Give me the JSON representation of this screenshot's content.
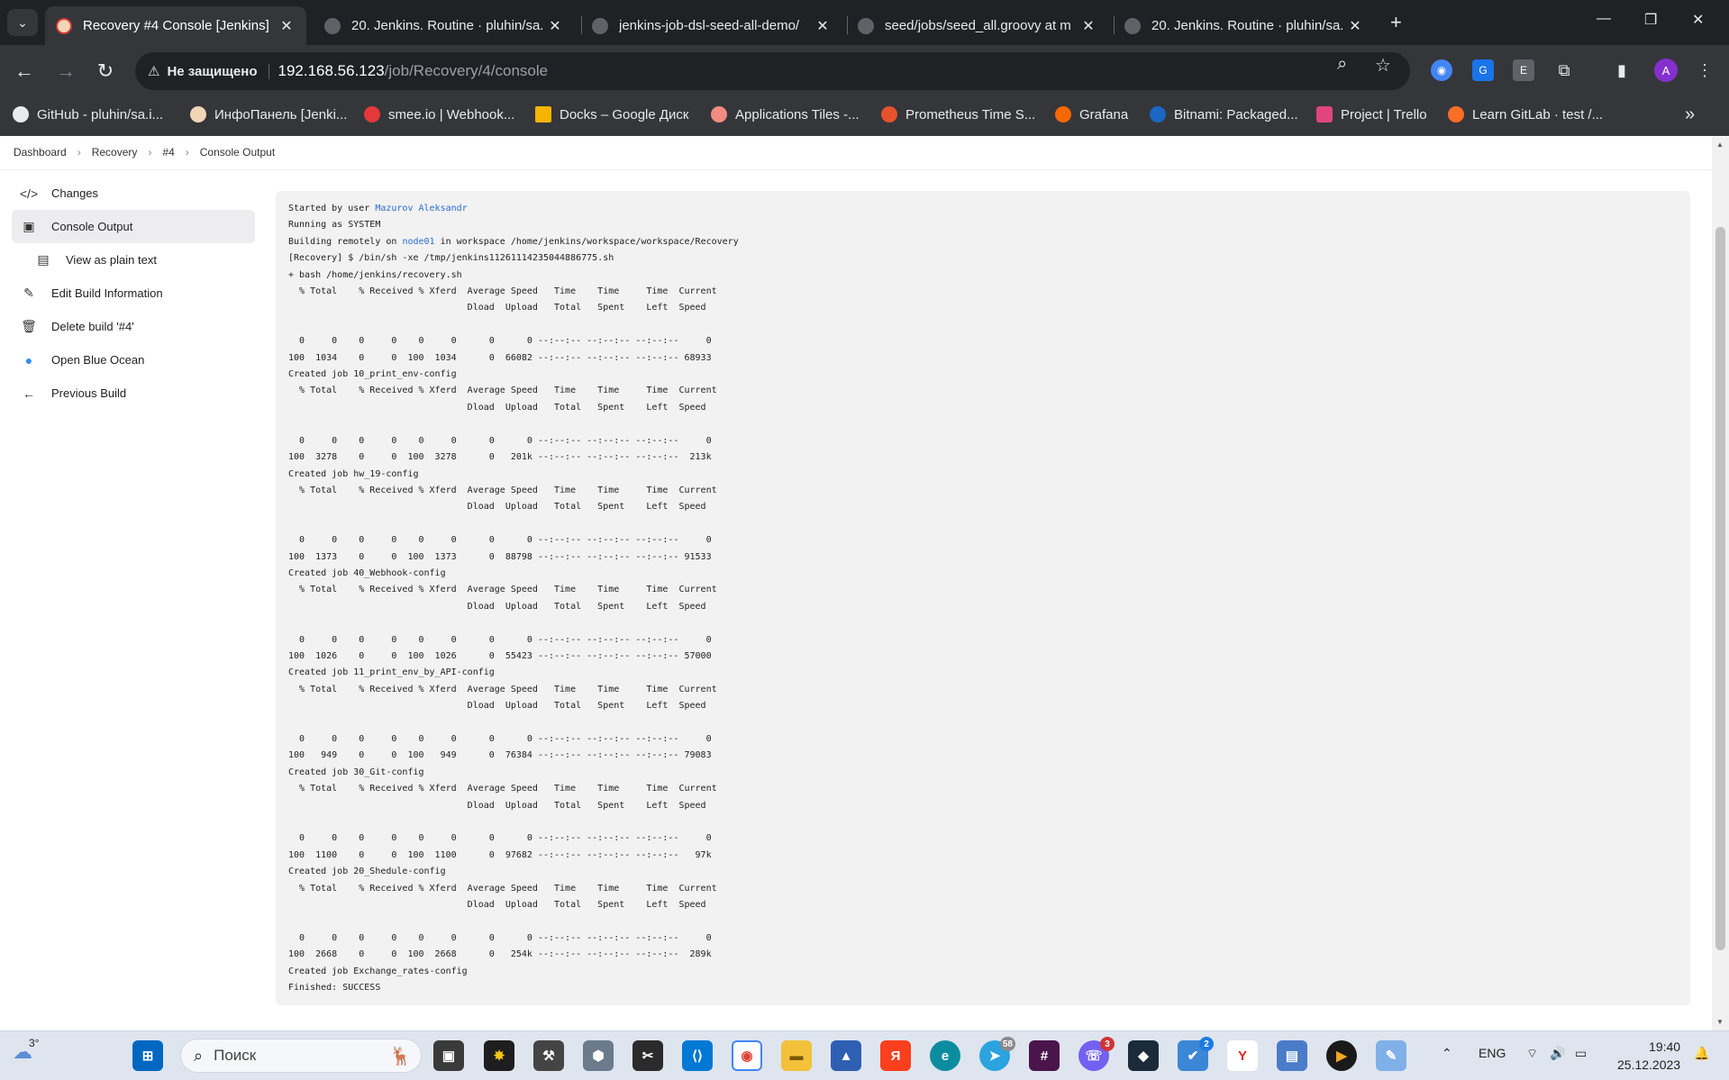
{
  "browser": {
    "tabs": [
      {
        "title": "Recovery #4 Console [Jenkins]",
        "active": true,
        "icon": "jenkins-icon"
      },
      {
        "title": "20. Jenkins. Routine · pluhin/sa.",
        "active": false,
        "icon": "github-icon"
      },
      {
        "title": "jenkins-job-dsl-seed-all-demo/",
        "active": false,
        "icon": "github-icon"
      },
      {
        "title": "seed/jobs/seed_all.groovy at m",
        "active": false,
        "icon": "github-icon"
      },
      {
        "title": "20. Jenkins. Routine · pluhin/sa.",
        "active": false,
        "icon": "github-icon"
      }
    ],
    "close_glyph": "✕",
    "new_tab_glyph": "+",
    "address": {
      "security_label": "Не защищено",
      "host": "192.168.56.123",
      "path": "/job/Recovery/4/console"
    },
    "profile_initial": "A",
    "bookmarks": [
      {
        "label": "GitHub - pluhin/sa.i...",
        "color": "#e8eaed"
      },
      {
        "label": "ИнфоПанель [Jenki...",
        "color": "#f0d6b7"
      },
      {
        "label": "smee.io | Webhook...",
        "color": "#e5383b"
      },
      {
        "label": "Docks – Google Диск",
        "color": "#f4b400"
      },
      {
        "label": "Applications Tiles -...",
        "color": "#f28b82"
      },
      {
        "label": "Prometheus Time S...",
        "color": "#e6522c"
      },
      {
        "label": "Grafana",
        "color": "#f46800"
      },
      {
        "label": "Bitnami: Packaged...",
        "color": "#1b67c3"
      },
      {
        "label": "Project | Trello",
        "color": "#e0457b"
      },
      {
        "label": "Learn GitLab · test /...",
        "color": "#fc6d26"
      }
    ]
  },
  "breadcrumb": [
    "Dashboard",
    "Recovery",
    "#4",
    "Console Output"
  ],
  "sidebar": {
    "items": [
      {
        "label": "Changes",
        "icon": "code-icon",
        "glyph": "</>"
      },
      {
        "label": "Console Output",
        "icon": "terminal-icon",
        "glyph": "▣"
      },
      {
        "label": "View as plain text",
        "icon": "document-icon",
        "glyph": "▤"
      },
      {
        "label": "Edit Build Information",
        "icon": "edit-icon",
        "glyph": "✎"
      },
      {
        "label": "Delete build '#4'",
        "icon": "trash-icon",
        "glyph": "🗑"
      },
      {
        "label": "Open Blue Ocean",
        "icon": "blue-ocean-icon",
        "glyph": "●"
      },
      {
        "label": "Previous Build",
        "icon": "arrow-left-icon",
        "glyph": "←"
      }
    ]
  },
  "console": {
    "started_prefix": "Started by user ",
    "user": "Mazurov Aleksandr",
    "running": "Running as SYSTEM",
    "building_prefix": "Building remotely on ",
    "node": "node01",
    "building_suffix": " in workspace /home/jenkins/workspace/workspace/Recovery",
    "lines": [
      "[Recovery] $ /bin/sh -xe /tmp/jenkins11261114235044886775.sh",
      "+ bash /home/jenkins/recovery.sh",
      "  % Total    % Received % Xferd  Average Speed   Time    Time     Time  Current",
      "                                 Dload  Upload   Total   Spent    Left  Speed",
      "",
      "  0     0    0     0    0     0      0      0 --:--:-- --:--:-- --:--:--     0",
      "100  1034    0     0  100  1034      0  66082 --:--:-- --:--:-- --:--:-- 68933",
      "Created job 10_print_env-config",
      "  % Total    % Received % Xferd  Average Speed   Time    Time     Time  Current",
      "                                 Dload  Upload   Total   Spent    Left  Speed",
      "",
      "  0     0    0     0    0     0      0      0 --:--:-- --:--:-- --:--:--     0",
      "100  3278    0     0  100  3278      0   201k --:--:-- --:--:-- --:--:--  213k",
      "Created job hw_19-config",
      "  % Total    % Received % Xferd  Average Speed   Time    Time     Time  Current",
      "                                 Dload  Upload   Total   Spent    Left  Speed",
      "",
      "  0     0    0     0    0     0      0      0 --:--:-- --:--:-- --:--:--     0",
      "100  1373    0     0  100  1373      0  88798 --:--:-- --:--:-- --:--:-- 91533",
      "Created job 40_Webhook-config",
      "  % Total    % Received % Xferd  Average Speed   Time    Time     Time  Current",
      "                                 Dload  Upload   Total   Spent    Left  Speed",
      "",
      "  0     0    0     0    0     0      0      0 --:--:-- --:--:-- --:--:--     0",
      "100  1026    0     0  100  1026      0  55423 --:--:-- --:--:-- --:--:-- 57000",
      "Created job 11_print_env_by_API-config",
      "  % Total    % Received % Xferd  Average Speed   Time    Time     Time  Current",
      "                                 Dload  Upload   Total   Spent    Left  Speed",
      "",
      "  0     0    0     0    0     0      0      0 --:--:-- --:--:-- --:--:--     0",
      "100   949    0     0  100   949      0  76384 --:--:-- --:--:-- --:--:-- 79083",
      "Created job 30_Git-config",
      "  % Total    % Received % Xferd  Average Speed   Time    Time     Time  Current",
      "                                 Dload  Upload   Total   Spent    Left  Speed",
      "",
      "  0     0    0     0    0     0      0      0 --:--:-- --:--:-- --:--:--     0",
      "100  1100    0     0  100  1100      0  97682 --:--:-- --:--:-- --:--:--   97k",
      "Created job 20_Shedule-config",
      "  % Total    % Received % Xferd  Average Speed   Time    Time     Time  Current",
      "                                 Dload  Upload   Total   Spent    Left  Speed",
      "",
      "  0     0    0     0    0     0      0      0 --:--:-- --:--:-- --:--:--     0",
      "100  2668    0     0  100  2668      0   254k --:--:-- --:--:-- --:--:--  289k",
      "Created job Exchange_rates-config",
      "Finished: SUCCESS"
    ]
  },
  "taskbar": {
    "weather": "3°",
    "search_placeholder": "Поиск",
    "badges": {
      "telegram": "58",
      "viber": "3",
      "tasks": "2"
    },
    "language": "ENG",
    "time": "19:40",
    "date": "25.12.2023"
  }
}
